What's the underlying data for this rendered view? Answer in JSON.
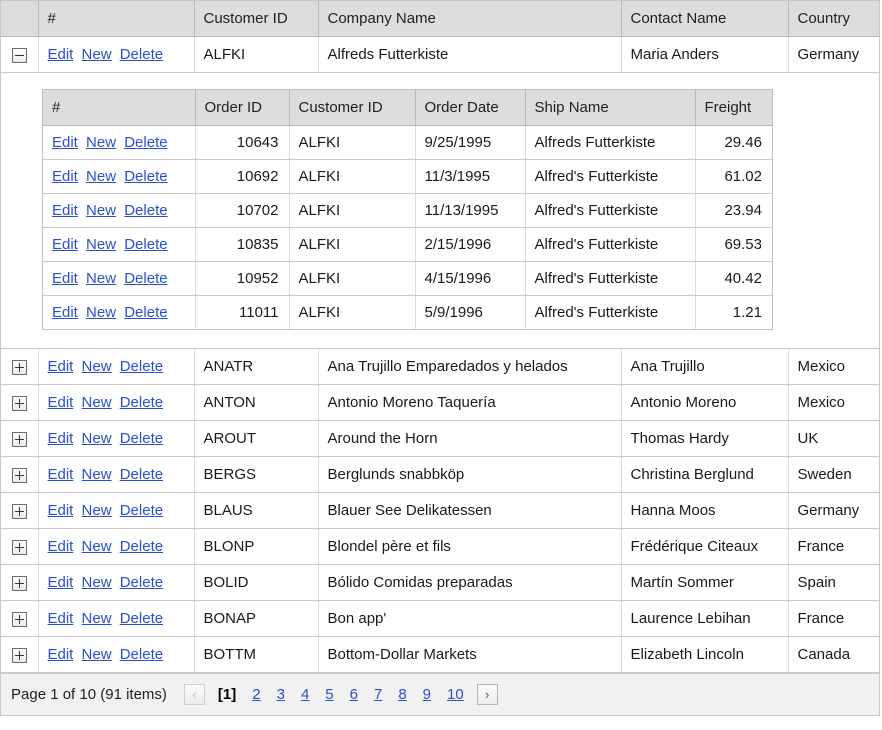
{
  "grid": {
    "columns": [
      {
        "key": "expand",
        "label": ""
      },
      {
        "key": "commands",
        "label": "#"
      },
      {
        "key": "customer_id",
        "label": "Customer ID"
      },
      {
        "key": "company_name",
        "label": "Company Name"
      },
      {
        "key": "contact_name",
        "label": "Contact Name"
      },
      {
        "key": "country",
        "label": "Country"
      }
    ],
    "commands": {
      "edit": "Edit",
      "new": "New",
      "delete": "Delete"
    },
    "icons": {
      "collapse": "minus-box-icon",
      "expand": "plus-box-icon",
      "prev": "chevron-left-icon",
      "next": "chevron-right-icon"
    },
    "rows": [
      {
        "expanded": true,
        "customer_id": "ALFKI",
        "company_name": "Alfreds Futterkiste",
        "contact_name": "Maria Anders",
        "country": "Germany"
      },
      {
        "expanded": false,
        "customer_id": "ANATR",
        "company_name": "Ana Trujillo Emparedados y helados",
        "contact_name": "Ana Trujillo",
        "country": "Mexico"
      },
      {
        "expanded": false,
        "customer_id": "ANTON",
        "company_name": "Antonio Moreno Taquería",
        "contact_name": "Antonio Moreno",
        "country": "Mexico"
      },
      {
        "expanded": false,
        "customer_id": "AROUT",
        "company_name": "Around the Horn",
        "contact_name": "Thomas Hardy",
        "country": "UK"
      },
      {
        "expanded": false,
        "customer_id": "BERGS",
        "company_name": "Berglunds snabbköp",
        "contact_name": "Christina Berglund",
        "country": "Sweden"
      },
      {
        "expanded": false,
        "customer_id": "BLAUS",
        "company_name": "Blauer See Delikatessen",
        "contact_name": "Hanna Moos",
        "country": "Germany"
      },
      {
        "expanded": false,
        "customer_id": "BLONP",
        "company_name": "Blondel père et fils",
        "contact_name": "Frédérique Citeaux",
        "country": "France"
      },
      {
        "expanded": false,
        "customer_id": "BOLID",
        "company_name": "Bólido Comidas preparadas",
        "contact_name": "Martín Sommer",
        "country": "Spain"
      },
      {
        "expanded": false,
        "customer_id": "BONAP",
        "company_name": "Bon app'",
        "contact_name": "Laurence Lebihan",
        "country": "France"
      },
      {
        "expanded": false,
        "customer_id": "BOTTM",
        "company_name": "Bottom-Dollar Markets",
        "contact_name": "Elizabeth Lincoln",
        "country": "Canada"
      }
    ]
  },
  "detail_grid": {
    "columns": [
      {
        "key": "commands",
        "label": "#"
      },
      {
        "key": "order_id",
        "label": "Order ID"
      },
      {
        "key": "customer_id",
        "label": "Customer ID"
      },
      {
        "key": "order_date",
        "label": "Order Date"
      },
      {
        "key": "ship_name",
        "label": "Ship Name"
      },
      {
        "key": "freight",
        "label": "Freight"
      }
    ],
    "rows": [
      {
        "order_id": "10643",
        "customer_id": "ALFKI",
        "order_date": "9/25/1995",
        "ship_name": "Alfreds Futterkiste",
        "freight": "29.46"
      },
      {
        "order_id": "10692",
        "customer_id": "ALFKI",
        "order_date": "11/3/1995",
        "ship_name": "Alfred's Futterkiste",
        "freight": "61.02"
      },
      {
        "order_id": "10702",
        "customer_id": "ALFKI",
        "order_date": "11/13/1995",
        "ship_name": "Alfred's Futterkiste",
        "freight": "23.94"
      },
      {
        "order_id": "10835",
        "customer_id": "ALFKI",
        "order_date": "2/15/1996",
        "ship_name": "Alfred's Futterkiste",
        "freight": "69.53"
      },
      {
        "order_id": "10952",
        "customer_id": "ALFKI",
        "order_date": "4/15/1996",
        "ship_name": "Alfred's Futterkiste",
        "freight": "40.42"
      },
      {
        "order_id": "11011",
        "customer_id": "ALFKI",
        "order_date": "5/9/1996",
        "ship_name": "Alfred's Futterkiste",
        "freight": "1.21"
      }
    ]
  },
  "pager": {
    "status": "Page 1 of 10 (91 items)",
    "prev_label": "‹",
    "next_label": "›",
    "prev_enabled": false,
    "next_enabled": true,
    "current_page": "[1]",
    "pages": [
      "2",
      "3",
      "4",
      "5",
      "6",
      "7",
      "8",
      "9",
      "10"
    ]
  },
  "colors": {
    "header_bg": "#dddddd",
    "link": "#2a4fd0",
    "pager_bg": "#f1f1f1",
    "border": "#c9c9c9"
  }
}
